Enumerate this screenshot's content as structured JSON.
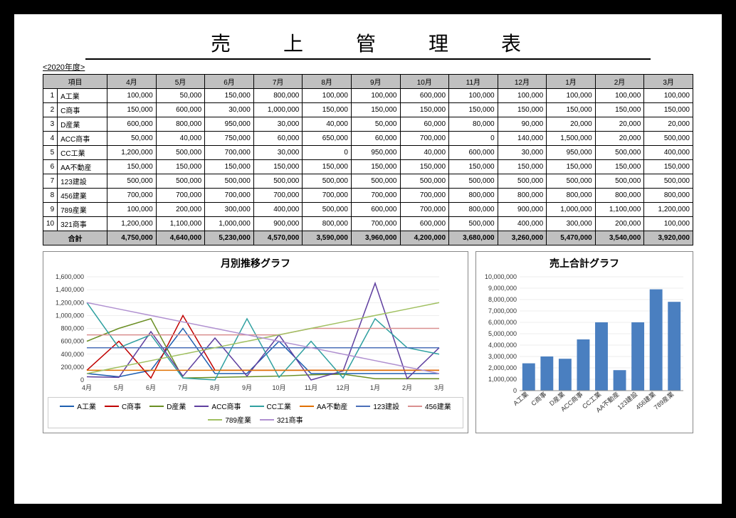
{
  "title": "売　　上　　管　　理　　表",
  "fiscal_year": "<2020年度>",
  "headers": [
    "項目",
    "4月",
    "5月",
    "6月",
    "7月",
    "8月",
    "9月",
    "10月",
    "11月",
    "12月",
    "1月",
    "2月",
    "3月"
  ],
  "rows": [
    {
      "idx": 1,
      "name": "A工業",
      "vals": [
        100000,
        50000,
        150000,
        800000,
        100000,
        100000,
        600000,
        100000,
        100000,
        100000,
        100000,
        100000
      ]
    },
    {
      "idx": 2,
      "name": "C商事",
      "vals": [
        150000,
        600000,
        30000,
        1000000,
        150000,
        150000,
        150000,
        150000,
        150000,
        150000,
        150000,
        150000
      ]
    },
    {
      "idx": 3,
      "name": "D産業",
      "vals": [
        600000,
        800000,
        950000,
        30000,
        40000,
        50000,
        60000,
        80000,
        90000,
        20000,
        20000,
        20000
      ]
    },
    {
      "idx": 4,
      "name": "ACC商事",
      "vals": [
        50000,
        40000,
        750000,
        60000,
        650000,
        60000,
        700000,
        0,
        140000,
        1500000,
        20000,
        500000
      ]
    },
    {
      "idx": 5,
      "name": "CC工業",
      "vals": [
        1200000,
        500000,
        700000,
        30000,
        0,
        950000,
        40000,
        600000,
        30000,
        950000,
        500000,
        400000
      ]
    },
    {
      "idx": 6,
      "name": "AA不動産",
      "vals": [
        150000,
        150000,
        150000,
        150000,
        150000,
        150000,
        150000,
        150000,
        150000,
        150000,
        150000,
        150000
      ]
    },
    {
      "idx": 7,
      "name": "123建設",
      "vals": [
        500000,
        500000,
        500000,
        500000,
        500000,
        500000,
        500000,
        500000,
        500000,
        500000,
        500000,
        500000
      ]
    },
    {
      "idx": 8,
      "name": "456建業",
      "vals": [
        700000,
        700000,
        700000,
        700000,
        700000,
        700000,
        700000,
        800000,
        800000,
        800000,
        800000,
        800000
      ]
    },
    {
      "idx": 9,
      "name": "789産業",
      "vals": [
        100000,
        200000,
        300000,
        400000,
        500000,
        600000,
        700000,
        800000,
        900000,
        1000000,
        1100000,
        1200000
      ]
    },
    {
      "idx": 10,
      "name": "321商事",
      "vals": [
        1200000,
        1100000,
        1000000,
        900000,
        800000,
        700000,
        600000,
        500000,
        400000,
        300000,
        200000,
        100000
      ]
    }
  ],
  "total_label": "合計",
  "totals": [
    4750000,
    4640000,
    5230000,
    4570000,
    3590000,
    3960000,
    4200000,
    3680000,
    3260000,
    5470000,
    3540000,
    3920000
  ],
  "chart_data": [
    {
      "type": "line",
      "title": "月別推移グラフ",
      "categories": [
        "4月",
        "5月",
        "6月",
        "7月",
        "8月",
        "9月",
        "10月",
        "11月",
        "12月",
        "1月",
        "2月",
        "3月"
      ],
      "ylim": [
        0,
        1600000
      ],
      "yticks": [
        0,
        200000,
        400000,
        600000,
        800000,
        1000000,
        1200000,
        1400000,
        1600000
      ],
      "series": [
        {
          "name": "A工業",
          "color": "#1f5fb0",
          "values": [
            100000,
            50000,
            150000,
            800000,
            100000,
            100000,
            600000,
            100000,
            100000,
            100000,
            100000,
            100000
          ]
        },
        {
          "name": "C商事",
          "color": "#c00000",
          "values": [
            150000,
            600000,
            30000,
            1000000,
            150000,
            150000,
            150000,
            150000,
            150000,
            150000,
            150000,
            150000
          ]
        },
        {
          "name": "D産業",
          "color": "#6a8e23",
          "values": [
            600000,
            800000,
            950000,
            30000,
            40000,
            50000,
            60000,
            80000,
            90000,
            20000,
            20000,
            20000
          ]
        },
        {
          "name": "ACC商事",
          "color": "#5f3f9f",
          "values": [
            50000,
            40000,
            750000,
            60000,
            650000,
            60000,
            700000,
            0,
            140000,
            1500000,
            20000,
            500000
          ]
        },
        {
          "name": "CC工業",
          "color": "#2fa0a0",
          "values": [
            1200000,
            500000,
            700000,
            30000,
            0,
            950000,
            40000,
            600000,
            30000,
            950000,
            500000,
            400000
          ]
        },
        {
          "name": "AA不動産",
          "color": "#e07000",
          "values": [
            150000,
            150000,
            150000,
            150000,
            150000,
            150000,
            150000,
            150000,
            150000,
            150000,
            150000,
            150000
          ]
        },
        {
          "name": "123建設",
          "color": "#4a6fb8",
          "values": [
            500000,
            500000,
            500000,
            500000,
            500000,
            500000,
            500000,
            500000,
            500000,
            500000,
            500000,
            500000
          ]
        },
        {
          "name": "456建業",
          "color": "#d98f8f",
          "values": [
            700000,
            700000,
            700000,
            700000,
            700000,
            700000,
            700000,
            800000,
            800000,
            800000,
            800000,
            800000
          ]
        },
        {
          "name": "789産業",
          "color": "#a0c060",
          "values": [
            100000,
            200000,
            300000,
            400000,
            500000,
            600000,
            700000,
            800000,
            900000,
            1000000,
            1100000,
            1200000
          ]
        },
        {
          "name": "321商事",
          "color": "#b090d0",
          "values": [
            1200000,
            1100000,
            1000000,
            900000,
            800000,
            700000,
            600000,
            500000,
            400000,
            300000,
            200000,
            100000
          ]
        }
      ]
    },
    {
      "type": "bar",
      "title": "売上合計グラフ",
      "categories": [
        "A工業",
        "C商事",
        "D産業",
        "ACC商事",
        "CC工業",
        "AA不動産",
        "123建設",
        "456建業",
        "789産業"
      ],
      "values": [
        2400000,
        3000000,
        2800000,
        4500000,
        6000000,
        1800000,
        6000000,
        8900000,
        7800000
      ],
      "ylim": [
        0,
        10000000
      ],
      "yticks": [
        0,
        1000000,
        2000000,
        3000000,
        4000000,
        5000000,
        6000000,
        7000000,
        8000000,
        9000000,
        10000000
      ],
      "color": "#4a7fc0"
    }
  ]
}
